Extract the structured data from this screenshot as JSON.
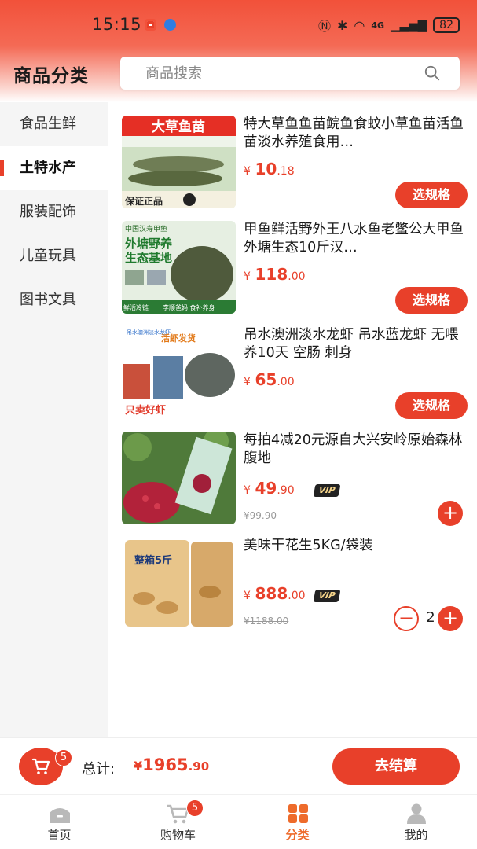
{
  "status_bar": {
    "time": "15:15",
    "battery": "82",
    "network": "4G"
  },
  "header": {
    "title": "商品分类",
    "search_placeholder": "商品搜索"
  },
  "sidebar": {
    "items": [
      {
        "label": "食品生鲜",
        "active": false
      },
      {
        "label": "土特水产",
        "active": true
      },
      {
        "label": "服装配饰",
        "active": false
      },
      {
        "label": "儿童玩具",
        "active": false
      },
      {
        "label": "图书文具",
        "active": false
      }
    ]
  },
  "products": [
    {
      "name": "特大草鱼鱼苗鲩鱼食蚊小草鱼苗活鱼苗淡水养殖食用…",
      "currency": "¥",
      "price_int": "10",
      "price_dec": ".18",
      "action": "选规格",
      "image_texts": [
        "大草鱼苗",
        "保证正品"
      ]
    },
    {
      "name": "甲鱼鲜活野外王八水鱼老鳖公大甲鱼外塘生态10斤汉…",
      "currency": "¥",
      "price_int": "118",
      "price_dec": ".00",
      "action": "选规格",
      "image_texts": [
        "中国汉寿甲鱼",
        "外塘野养",
        "生态基地",
        "鲜活冷链",
        "李顺爸妈 食补养身"
      ]
    },
    {
      "name": "吊水澳洲淡水龙虾 吊水蓝龙虾 无喂养10天 空肠 刺身",
      "currency": "¥",
      "price_int": "65",
      "price_dec": ".00",
      "action": "选规格",
      "image_texts": [
        "吊水澳洲淡水龙虾",
        "活虾发货",
        "只卖好虾"
      ]
    },
    {
      "name": "每拍4减20元源自大兴安岭原始森林腹地",
      "currency": "¥",
      "price_int": "49",
      "price_dec": ".90",
      "vip": "VIP",
      "old_price": "¥99.90",
      "action": "+"
    },
    {
      "name": "美味干花生5KG/袋装",
      "currency": "¥",
      "price_int": "888",
      "price_dec": ".00",
      "vip": "VIP",
      "old_price": "¥1188.00",
      "quantity": "2",
      "image_texts": [
        "整箱5斤"
      ]
    }
  ],
  "cart": {
    "count": "5",
    "total_label": "总计:",
    "currency": "¥",
    "total_int": "1965",
    "total_dec": ".90",
    "checkout_label": "去结算"
  },
  "tabbar": {
    "items": [
      {
        "label": "首页",
        "icon": "home-icon"
      },
      {
        "label": "购物车",
        "icon": "cart-icon",
        "badge": "5"
      },
      {
        "label": "分类",
        "icon": "category-icon",
        "active": true
      },
      {
        "label": "我的",
        "icon": "profile-icon"
      }
    ]
  },
  "colors": {
    "accent": "#e8402a",
    "active_tab": "#ee6b2b",
    "sidebar_bg": "#f5f5f5"
  }
}
